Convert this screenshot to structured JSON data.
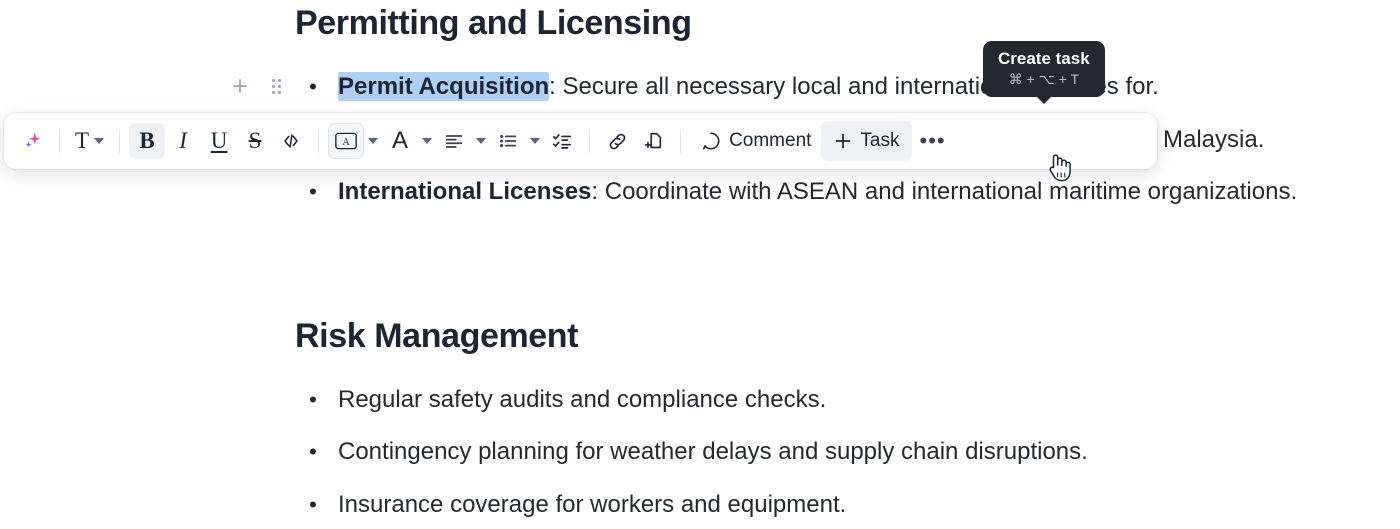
{
  "document": {
    "sections": [
      {
        "heading": "Permitting and Licensing",
        "bullets": [
          {
            "selected_text": "Permit Acquisition",
            "rest": ": Secure all necessary local and international licenses for."
          },
          {
            "bold": "",
            "rest": "Malaysia."
          },
          {
            "bold": "International Licenses",
            "rest": ": Coordinate with ASEAN and international maritime organizations."
          }
        ]
      },
      {
        "heading": "Risk Management",
        "bullets": [
          {
            "bold": "",
            "rest": "Regular safety audits and compliance checks."
          },
          {
            "bold": "",
            "rest": "Contingency planning for weather delays and supply chain disruptions."
          },
          {
            "bold": "",
            "rest": "Insurance coverage for workers and equipment."
          }
        ]
      }
    ],
    "bullet_glyph": "•"
  },
  "block_handles": {
    "add_label": "+",
    "drag_label": "drag-handle"
  },
  "toolbar": {
    "ai_label": "ai-sparkle",
    "text_style_label": "T",
    "bold_label": "B",
    "italic_label": "I",
    "underline_label": "U",
    "strikethrough_label": "S",
    "code_label": "</>",
    "highlight_label": "A",
    "text_color_label": "A",
    "align_label": "align",
    "list_label": "list",
    "checklist_label": "checklist",
    "link_label": "link",
    "attach_label": "attach-page",
    "comment_label": "Comment",
    "task_label": "Task",
    "task_plus": "+",
    "more_label": "•••",
    "bold_active": true,
    "highlight_active": true,
    "task_hover": true
  },
  "tooltip": {
    "title": "Create task",
    "shortcut": "⌘ + ⌥ + T"
  },
  "colors": {
    "selection_highlight": "#aed0f5",
    "toolbar_background": "#ffffff",
    "tooltip_background": "#242730",
    "active_button_background": "#eef0f3",
    "text": "#1d2433"
  }
}
